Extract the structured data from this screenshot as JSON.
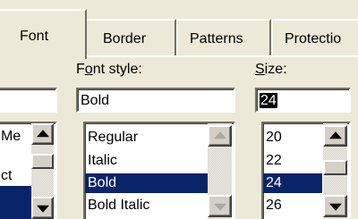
{
  "tabs": [
    {
      "label": "Font",
      "active": true
    },
    {
      "label": "Border",
      "active": false
    },
    {
      "label": "Patterns",
      "active": false
    },
    {
      "label": "Protectio",
      "active": false
    }
  ],
  "font": {
    "field_value": "",
    "items": [
      "Me",
      "",
      "ct",
      ""
    ],
    "selected_index": 3
  },
  "font_style": {
    "label_hotkey": "o",
    "label_before": "F",
    "label_after": "nt style:",
    "field_value": "Bold",
    "items": [
      "Regular",
      "Italic",
      "Bold",
      "Bold Italic"
    ],
    "selected_index": 2
  },
  "size": {
    "label_hotkey": "S",
    "label_after": "ize:",
    "field_value": "24",
    "items": [
      "20",
      "22",
      "24",
      "26"
    ],
    "selected_index": 2
  },
  "colors": {
    "face": "#ece9d8",
    "selection": "#0a246a"
  }
}
